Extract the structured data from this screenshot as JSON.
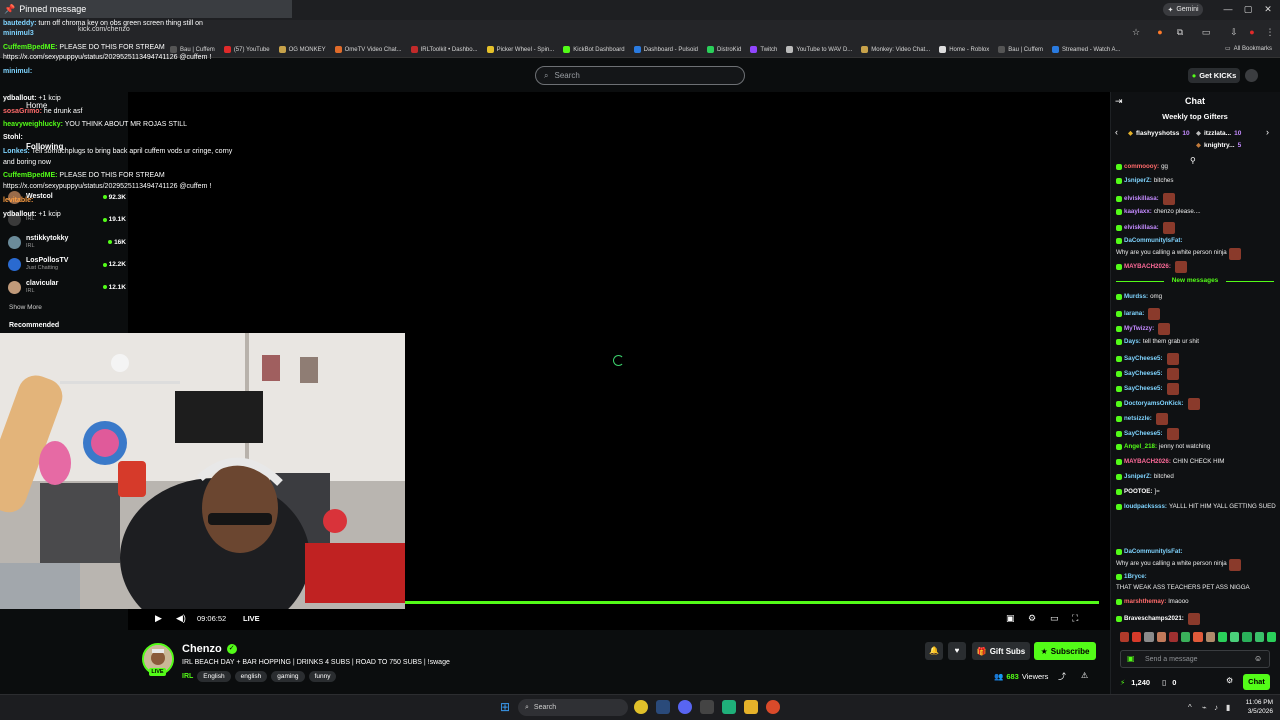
{
  "browser": {
    "url": "kick.com/chenzo",
    "gemini_label": "Gemini",
    "all_bookmarks": "All Bookmarks",
    "bookmarks": [
      {
        "label": "Bau | Cuffem",
        "color": "#555"
      },
      {
        "label": "(57) YouTube",
        "color": "#e02a2a"
      },
      {
        "label": "OG MONKEY",
        "color": "#c7a24a"
      },
      {
        "label": "OmeTV Video Chat...",
        "color": "#e06b2a"
      },
      {
        "label": "IRLToolkit • Dashbo...",
        "color": "#c22a2a"
      },
      {
        "label": "Picker Wheel - Spin...",
        "color": "#e5c12a"
      },
      {
        "label": "KickBot Dashboard",
        "color": "#53fc18"
      },
      {
        "label": "Dashboard - Pulsoid",
        "color": "#2a7be0"
      },
      {
        "label": "DistroKid",
        "color": "#2ad05a"
      },
      {
        "label": "Twitch",
        "color": "#9146ff"
      },
      {
        "label": "YouTube to WAV D...",
        "color": "#bbbbbb"
      },
      {
        "label": "Monkey: Video Chat...",
        "color": "#c7a24a"
      },
      {
        "label": "Home - Roblox",
        "color": "#dddddd"
      },
      {
        "label": "Bau | Cuffem",
        "color": "#555"
      },
      {
        "label": "Streamed - Watch A...",
        "color": "#2a7be0"
      }
    ]
  },
  "header": {
    "search_placeholder": "Search",
    "get_kicks": "Get KICKs"
  },
  "sidebar": {
    "home": "Home",
    "following": "Following",
    "show_more": "Show More",
    "recommended": "Recommended",
    "channels": [
      {
        "name": "Westcol",
        "category": "",
        "viewers": "92.3K"
      },
      {
        "name": "",
        "category": "IRL",
        "viewers": "19.1K"
      },
      {
        "name": "nstikkytokky",
        "category": "IRL",
        "viewers": "16K"
      },
      {
        "name": "LosPollosTV",
        "category": "Just Chatting",
        "viewers": "12.2K"
      },
      {
        "name": "clavicular",
        "category": "IRL",
        "viewers": "12.1K"
      }
    ]
  },
  "overlay": {
    "pinned_title": "Pinned message",
    "messages": [
      {
        "user": "bauteddy:",
        "text": "turn off chroma key on obs green screen thing still on",
        "color": "#7fd4ff"
      },
      {
        "user": "minimul3",
        "text": "",
        "color": "#7fd4ff"
      },
      {
        "user": "CuffemBpedME:",
        "text": "PLEASE DO THIS FOR STREAM",
        "color": "#53fc18"
      },
      {
        "user": "",
        "text": "https://x.com/sexypuppyu/status/2029525113494741126 @cuffem !",
        "color": "#fff"
      },
      {
        "user": "minimul:",
        "text": "",
        "color": "#7fd4ff"
      },
      {
        "user": "ydballout:",
        "text": "+1 kcip",
        "color": "#fff"
      },
      {
        "user": "sosaGrimo:",
        "text": "he drunk asf",
        "color": "#ff6b6b"
      },
      {
        "user": "heavyweighlucky:",
        "text": "YOU THINK ABOUT MR ROJAS STILL",
        "color": "#53fc18"
      },
      {
        "user": "Stohl:",
        "text": "",
        "color": "#fff"
      },
      {
        "user": "Lonkes:",
        "text": "Tell somuchplugs to bring back april cuffem vods ur cringe, corny",
        "color": "#7fd4ff"
      },
      {
        "user": "",
        "text": "and boring now",
        "color": "#fff"
      },
      {
        "user": "CuffemBpedME:",
        "text": "PLEASE DO THIS FOR STREAM",
        "color": "#53fc18"
      },
      {
        "user": "",
        "text": "https://x.com/sexypuppyu/status/2029525113494741126 @cuffem !",
        "color": "#fff"
      },
      {
        "user": "levitable:",
        "text": "",
        "color": "#ff9f43"
      },
      {
        "user": "ydballout:",
        "text": "+1 kcip",
        "color": "#fff"
      }
    ]
  },
  "player": {
    "timecode": "09:06:52",
    "live_label": "LIVE",
    "progress": 0.73
  },
  "stream": {
    "channel": "Chenzo",
    "live_badge": "LIVE",
    "title": "IRL BEACH DAY + BAR HOPPING | DRINKS 4 SUBS | ROAD TO 750 SUBS | !swage",
    "category": "IRL",
    "tags": [
      "English",
      "english",
      "gaming",
      "funny"
    ],
    "gift_subs": "Gift Subs",
    "subscribe": "Subscribe",
    "viewers_count": "683",
    "viewers_label": "Viewers"
  },
  "chat": {
    "title": "Chat",
    "weekly_top_gifters": "Weekly top Gifters",
    "gifters": [
      {
        "name": "flashyyshotss",
        "count": "10",
        "rank_color": "#e5b22a"
      },
      {
        "name": "itzzlata...",
        "count": "10",
        "rank_color": "#bbbbbb"
      },
      {
        "name": "knightry...",
        "count": "5",
        "rank_color": "#c27a3a"
      }
    ],
    "new_messages": "New messages",
    "messages_before": [
      {
        "user": "commoooy:",
        "text": "gg",
        "color": "#ff6b6b",
        "emote": false
      },
      {
        "user": "JsniperZ:",
        "text": "bitches",
        "color": "#7fd4ff",
        "emote": false
      },
      {
        "user": "elviskillasa:",
        "text": "",
        "color": "#c48bff",
        "emote": true
      },
      {
        "user": "kaaylaxx:",
        "text": "chenzo please....",
        "color": "#c48bff",
        "emote": false
      },
      {
        "user": "elviskillasa:",
        "text": "",
        "color": "#c48bff",
        "emote": true
      },
      {
        "user": "DaCommunityIsFat:",
        "text": "Why are you calling a white person ninja",
        "color": "#7fd4ff",
        "emote": true
      },
      {
        "user": "MAYBACH2026:",
        "text": "",
        "color": "#ff6b9a",
        "emote": true
      }
    ],
    "messages_after": [
      {
        "user": "Murdss:",
        "text": "omg",
        "color": "#7fd4ff",
        "emote": false
      },
      {
        "user": "larana:",
        "text": "",
        "color": "#7fd4ff",
        "emote": true
      },
      {
        "user": "MyTwizzy:",
        "text": "",
        "color": "#c48bff",
        "emote": true
      },
      {
        "user": "Days:",
        "text": "tell them grab ur shit",
        "color": "#7fd4ff",
        "emote": false
      },
      {
        "user": "SayCheese5:",
        "text": "",
        "color": "#7fd4ff",
        "emote": true
      },
      {
        "user": "SayCheese5:",
        "text": "",
        "color": "#7fd4ff",
        "emote": true
      },
      {
        "user": "SayCheese5:",
        "text": "",
        "color": "#7fd4ff",
        "emote": true
      },
      {
        "user": "DoctoryamsOnKick:",
        "text": "",
        "color": "#7fd4ff",
        "emote": true
      },
      {
        "user": "netsizzle:",
        "text": "",
        "color": "#7fd4ff",
        "emote": true
      },
      {
        "user": "SayCheese5:",
        "text": "",
        "color": "#7fd4ff",
        "emote": true
      },
      {
        "user": "Angel_218:",
        "text": "jenny not watching",
        "color": "#53fc18",
        "emote": false
      },
      {
        "user": "MAYBACH2026:",
        "text": "CHIN CHECK HIM",
        "color": "#ff6b9a",
        "emote": false
      },
      {
        "user": "JsniperZ:",
        "text": "bitched",
        "color": "#7fd4ff",
        "emote": false
      },
      {
        "user": "POOTOE:",
        "text": "]=",
        "color": "#ffffff",
        "emote": false
      },
      {
        "user": "loudpackssss:",
        "text": "YALLL HIT HIM YALL GETTING SUED",
        "color": "#7fd4ff",
        "emote": false
      },
      {
        "user": "DaCommunityIsFat:",
        "text": "Why are you calling a white person ninja",
        "color": "#7fd4ff",
        "emote": true
      },
      {
        "user": "1Bryce:",
        "text": "THAT WEAK ASS TEACHERS PET ASS NIGGA",
        "color": "#7fd4ff",
        "emote": false
      },
      {
        "user": "marshthemay:",
        "text": "lmaooo",
        "color": "#ff6b6b",
        "emote": false
      },
      {
        "user": "Braveschamps2021:",
        "text": "",
        "color": "#ffffff",
        "emote": true
      }
    ],
    "input_placeholder": "Send a message",
    "kicks_balance": "1,240",
    "second_count": "0",
    "chat_button": "Chat"
  },
  "taskbar": {
    "search_placeholder": "Search",
    "time": "11:06 PM",
    "date": "3/5/2026"
  },
  "colors": {
    "accent": "#53fc18",
    "background": "#0b0d0e",
    "chat_bg": "#0f1113"
  }
}
